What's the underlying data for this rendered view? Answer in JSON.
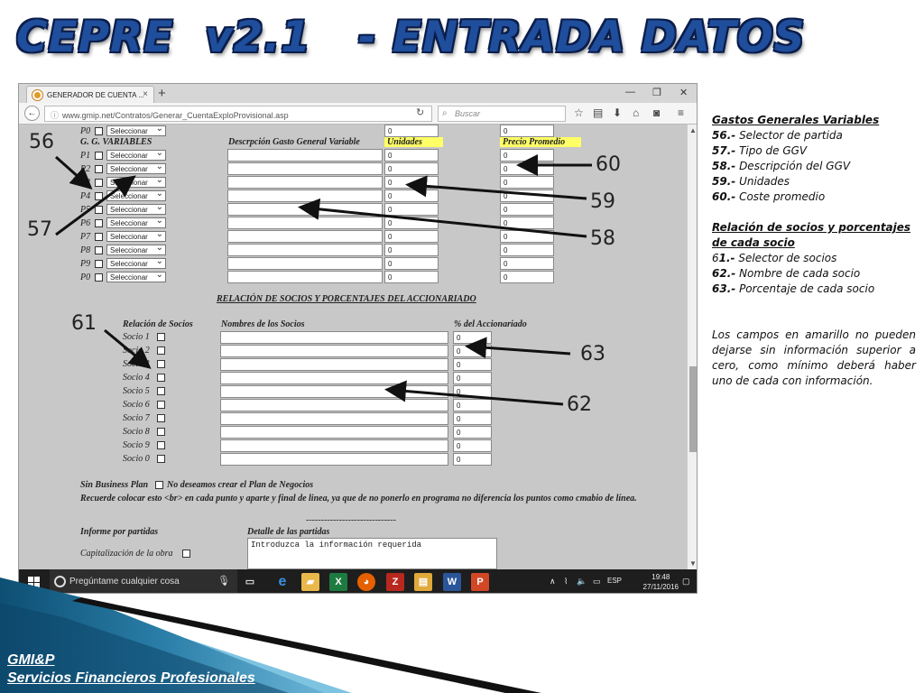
{
  "slide": {
    "title": "CEPRE  v2.1   - ENTRADA DATOS",
    "footer_line1": "GMI&P",
    "footer_line2": "Servicios Financieros Profesionales",
    "brand_color": "#1f4e9c"
  },
  "browser": {
    "tab_title": "GENERADOR DE CUENTA ...",
    "tab_close": "×",
    "new_tab": "+",
    "url": "www.gmip.net/Contratos/Generar_CuentaExploProvisional.asp",
    "search_placeholder": "Buscar",
    "minimize": "—",
    "maximize": "❐",
    "close": "✕"
  },
  "form": {
    "p0_top": {
      "label": "P0",
      "select": "Seleccionar",
      "unidades": "0",
      "precio": "0"
    },
    "ggv_header": "G. G. VARIABLES",
    "desc_header": "Descrpción Gasto General Variable",
    "unidades_header": "Unidades",
    "precio_header": "Precio Promedio",
    "rows": [
      {
        "label": "P1",
        "select": "Seleccionar",
        "desc": "",
        "unidades": "0",
        "precio": "0"
      },
      {
        "label": "P2",
        "select": "Seleccionar",
        "desc": "",
        "unidades": "0",
        "precio": "0"
      },
      {
        "label": "P3",
        "select": "Seleccionar",
        "desc": "",
        "unidades": "0",
        "precio": "0"
      },
      {
        "label": "P4",
        "select": "Seleccionar",
        "desc": "",
        "unidades": "0",
        "precio": "0"
      },
      {
        "label": "P5",
        "select": "Seleccionar",
        "desc": "",
        "unidades": "0",
        "precio": "0"
      },
      {
        "label": "P6",
        "select": "Seleccionar",
        "desc": "",
        "unidades": "0",
        "precio": "0"
      },
      {
        "label": "P7",
        "select": "Seleccionar",
        "desc": "",
        "unidades": "0",
        "precio": "0"
      },
      {
        "label": "P8",
        "select": "Seleccionar",
        "desc": "",
        "unidades": "0",
        "precio": "0"
      },
      {
        "label": "P9",
        "select": "Seleccionar",
        "desc": "",
        "unidades": "0",
        "precio": "0"
      },
      {
        "label": "P0",
        "select": "Seleccionar",
        "desc": "",
        "unidades": "0",
        "precio": "0"
      }
    ],
    "socios_section_title": "RELACIÓN DE SOCIOS Y PORCENTAJES DEL ACCIONARIADO",
    "socios_header": "Relación de Socios",
    "nombres_header": "Nombres de los Socios",
    "pct_header": "% del Accionariado",
    "socios": [
      {
        "label": "Socio 1",
        "nombre": "",
        "pct": "0"
      },
      {
        "label": "Socio 2",
        "nombre": "",
        "pct": "0"
      },
      {
        "label": "Socio 3",
        "nombre": "",
        "pct": "0"
      },
      {
        "label": "Socio 4",
        "nombre": "",
        "pct": "0"
      },
      {
        "label": "Socio 5",
        "nombre": "",
        "pct": "0"
      },
      {
        "label": "Socio 6",
        "nombre": "",
        "pct": "0"
      },
      {
        "label": "Socio 7",
        "nombre": "",
        "pct": "0"
      },
      {
        "label": "Socio 8",
        "nombre": "",
        "pct": "0"
      },
      {
        "label": "Socio 9",
        "nombre": "",
        "pct": "0"
      },
      {
        "label": "Socio 0",
        "nombre": "",
        "pct": "0"
      }
    ],
    "sin_bp_label": "Sin Business Plan",
    "sin_bp_text": "No deseamos crear el Plan de Negocios",
    "recuerde_text": "Recuerde colocar esto <br> en cada punto y aparte y final de linea, ya que de no ponerlo en programa no diferencia los puntos como cmabio de línea.",
    "separator": "------------------------------",
    "informe_label": "Informe por partidas",
    "detalle_label": "Detalle de las partidas",
    "capitalizacion_label": "Capitalización de la obra",
    "textarea_value": "Introduzca la información requerida"
  },
  "taskbar": {
    "search_placeholder": "Pregúntame cualquier cosa",
    "lang": "ESP",
    "time": "19:48",
    "date": "27/11/2016"
  },
  "callouts": {
    "c56": "56",
    "c57": "57",
    "c58": "58",
    "c59": "59",
    "c60": "60",
    "c61": "61",
    "c62": "62",
    "c63": "63"
  },
  "notes": {
    "ggv_title": "Gastos Generales Variables",
    "n56": "56.-",
    "n56_text": " Selector de partida",
    "n57": "57.-",
    "n57_text": " Tipo de GGV",
    "n58": "58.-",
    "n58_text": " Descripción del GGV",
    "n59": "59.-",
    "n59_text": " Unidades",
    "n60": "60.-",
    "n60_text": " Coste promedio",
    "socios_title": "Relación de socios y porcentajes de cada socio",
    "n61_a": "6",
    "n61_b": "1.-",
    "n61_text": " Selector de socios",
    "n62": "62.-",
    "n62_text": " Nombre de cada socio",
    "n63": "63.-",
    "n63_text": " Porcentaje de cada socio",
    "warning": "Los campos en amarillo no pueden dejarse sin información superior a cero, como mínimo deberá haber uno de cada con información."
  }
}
